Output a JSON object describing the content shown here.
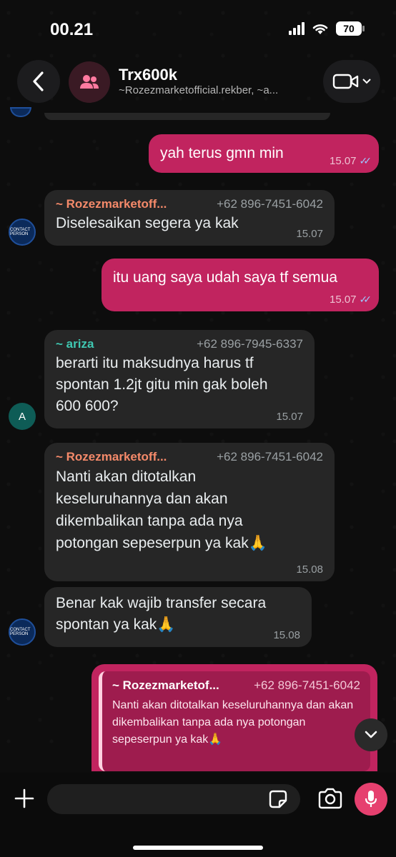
{
  "status": {
    "time": "00.21",
    "battery": "70"
  },
  "header": {
    "title": "Trx600k",
    "subtitle": "~Rozezmarketofficial.rekber, ~a..."
  },
  "messages": [
    {
      "type": "out",
      "text": "yah terus gmn min",
      "time": "15.07"
    },
    {
      "type": "in",
      "sender": "~ Rozezmarketoff...",
      "phone": "+62 896-7451-6042",
      "text": "Diselesaikan segera ya kak",
      "time": "15.07"
    },
    {
      "type": "out",
      "text": "itu uang saya udah saya tf semua",
      "time": "15.07"
    },
    {
      "type": "in",
      "sender": "~ ariza",
      "phone": "+62 896-7945-6337",
      "text": "berarti itu maksudnya harus tf spontan 1.2jt gitu min gak boleh 600 600?",
      "time": "15.07"
    },
    {
      "type": "in",
      "sender": "~ Rozezmarketoff...",
      "phone": "+62 896-7451-6042",
      "text": "Nanti akan ditotalkan keseluruhannya dan akan dikembalikan tanpa ada nya potongan sepeserpun ya kak🙏",
      "time": "15.08"
    },
    {
      "type": "in",
      "text": "Benar kak wajib transfer secara spontan ya kak🙏",
      "time": "15.08"
    }
  ],
  "avatars": {
    "a_letter": "A",
    "logo_text": "CONTACT PERSON"
  },
  "quote": {
    "sender": "~ Rozezmarketof...",
    "phone": "+62 896-7451-6042",
    "text": "Nanti akan ditotalkan keseluruhannya dan akan dikembalikan tanpa ada nya potongan sepeserpun ya kak🙏"
  },
  "composer": {
    "placeholder": ""
  },
  "colors": {
    "outgoing": "#c1245f",
    "incoming": "#262626",
    "ariza_name": "#3fc8b2",
    "rozez_name": "#f58a6a",
    "mic": "#e6406f"
  }
}
